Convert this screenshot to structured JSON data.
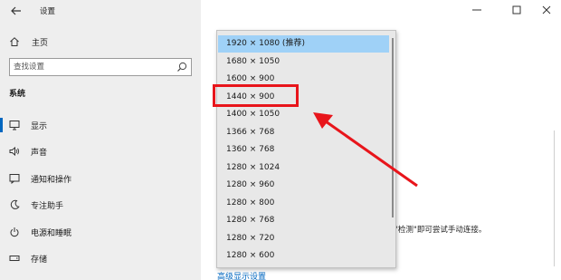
{
  "window": {
    "title": "设置"
  },
  "sidebar": {
    "home_label": "主页",
    "search_placeholder": "查找设置",
    "section_title": "系统",
    "items": [
      {
        "label": "显示",
        "icon": "monitor-icon",
        "active": true
      },
      {
        "label": "声音",
        "icon": "speaker-icon",
        "active": false
      },
      {
        "label": "通知和操作",
        "icon": "notification-icon",
        "active": false
      },
      {
        "label": "专注助手",
        "icon": "moon-icon",
        "active": false
      },
      {
        "label": "电源和睡眠",
        "icon": "power-icon",
        "active": false
      },
      {
        "label": "存储",
        "icon": "storage-icon",
        "active": false
      }
    ]
  },
  "resolution_dropdown": {
    "options": [
      "1920 × 1080 (推荐)",
      "1680 × 1050",
      "1600 × 900",
      "1440 × 900",
      "1400 × 1050",
      "1366 × 768",
      "1360 × 768",
      "1280 × 1024",
      "1280 × 960",
      "1280 × 800",
      "1280 × 768",
      "1280 × 720",
      "1280 × 600"
    ],
    "selected_index": 0,
    "highlighted_option": "1440 × 900"
  },
  "main": {
    "help_text": "\"检测\"即可尝试手动连接。",
    "advanced_link": "高级显示设置"
  },
  "colors": {
    "sidebar_bg": "#eeeeee",
    "accent": "#0067c0",
    "selected_bg": "#9fd1f7",
    "annotation_red": "#e8151b"
  }
}
